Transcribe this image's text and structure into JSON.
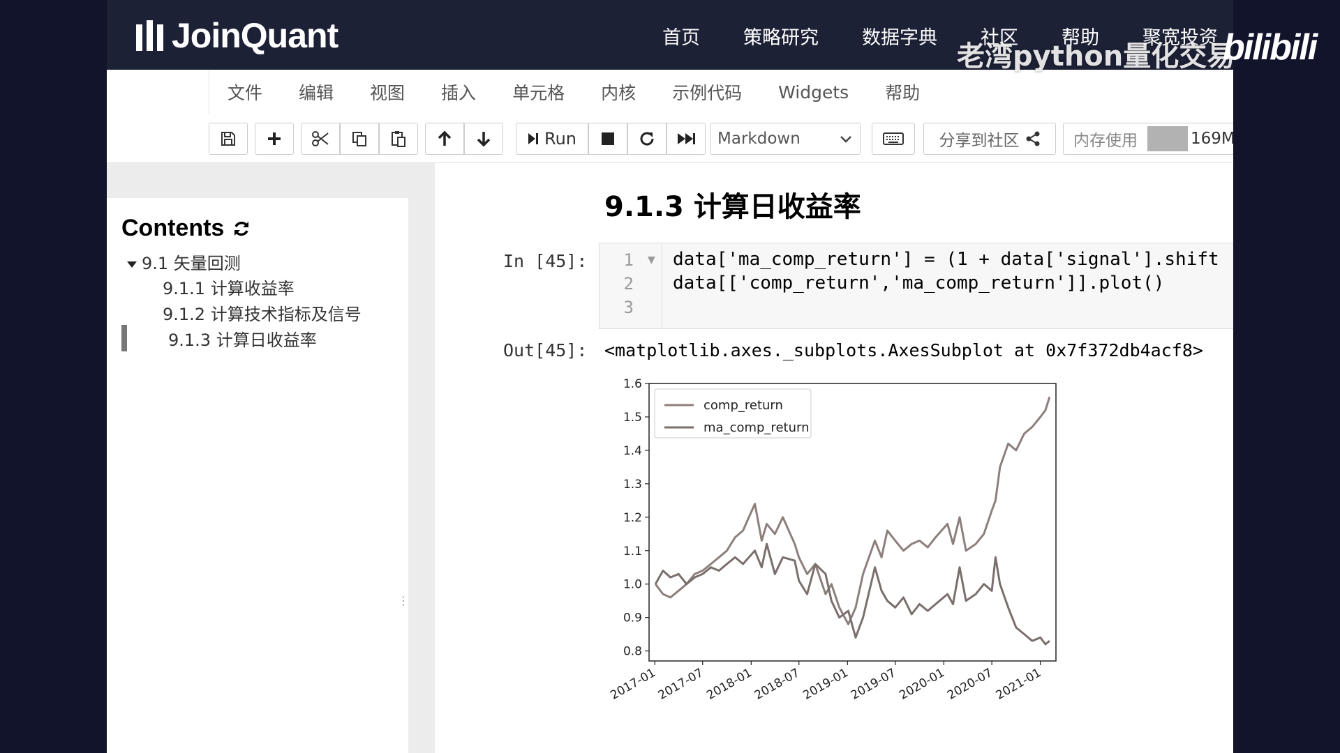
{
  "brand": {
    "name": "JoinQuant"
  },
  "top_nav": [
    "首页",
    "策略研究",
    "数据字典",
    "社区",
    "帮助",
    "聚宽投资"
  ],
  "watermark": {
    "text": "老湾python量化交易",
    "logo": "bilibili"
  },
  "menu": [
    "文件",
    "编辑",
    "视图",
    "插入",
    "单元格",
    "内核",
    "示例代码",
    "Widgets",
    "帮助"
  ],
  "toolbar": {
    "run_label": "Run",
    "cell_type": "Markdown",
    "share_label": "分享到社区",
    "memory_label": "内存使用",
    "memory_value": "169M",
    "memory_fraction": 0.3,
    "icons": [
      "save-icon",
      "plus-icon",
      "scissors-icon",
      "copy-icon",
      "paste-icon",
      "arrow-up-icon",
      "arrow-down-icon",
      "run-icon",
      "stop-icon",
      "restart-icon",
      "fast-forward-icon",
      "keyboard-icon",
      "share-icon"
    ]
  },
  "toc": {
    "title": "Contents",
    "items": [
      {
        "label": "9.1 矢量回测"
      },
      {
        "label": "9.1.1 计算收益率"
      },
      {
        "label": "9.1.2 计算技术指标及信号"
      },
      {
        "label": "9.1.3 计算日收益率"
      }
    ]
  },
  "notebook": {
    "heading": "9.1.3 计算日收益率",
    "in_prompt": "In [45]:",
    "out_prompt": "Out[45]:",
    "line_numbers": [
      "1",
      "2",
      "3"
    ],
    "code_lines": [
      "data['ma_comp_return'] = (1 + data['signal'].shift",
      "data[['comp_return','ma_comp_return']].plot()",
      ""
    ],
    "output_text": "<matplotlib.axes._subplots.AxesSubplot at 0x7f372db4acf8>"
  },
  "chart_data": {
    "type": "line",
    "title": "",
    "xlabel": "",
    "ylabel": "",
    "legend_position": "top-left",
    "grid": false,
    "ylim": [
      0.77,
      1.6
    ],
    "xlim": [
      "2016-12-10",
      "2021-03-01"
    ],
    "yticks": [
      "0.8",
      "0.9",
      "1.0",
      "1.1",
      "1.2",
      "1.3",
      "1.4",
      "1.5",
      "1.6"
    ],
    "xticks": [
      "2017-01",
      "2017-07",
      "2018-01",
      "2018-07",
      "2019-01",
      "2019-07",
      "2020-01",
      "2020-07",
      "2021-01"
    ],
    "series": [
      {
        "name": "comp_return",
        "color": "#8c7f7c",
        "x": [
          "2017-01-03",
          "2017-02-01",
          "2017-03-01",
          "2017-04-01",
          "2017-05-01",
          "2017-06-01",
          "2017-07-01",
          "2017-08-01",
          "2017-09-01",
          "2017-10-01",
          "2017-11-01",
          "2017-12-01",
          "2018-01-15",
          "2018-02-10",
          "2018-03-01",
          "2018-04-01",
          "2018-05-01",
          "2018-06-15",
          "2018-07-01",
          "2018-08-01",
          "2018-09-01",
          "2018-10-10",
          "2018-11-01",
          "2018-12-01",
          "2019-01-04",
          "2019-02-01",
          "2019-03-01",
          "2019-04-15",
          "2019-05-10",
          "2019-06-01",
          "2019-07-01",
          "2019-08-01",
          "2019-09-01",
          "2019-10-01",
          "2019-11-01",
          "2019-12-01",
          "2020-01-15",
          "2020-02-05",
          "2020-03-01",
          "2020-03-25",
          "2020-05-01",
          "2020-06-01",
          "2020-07-01",
          "2020-07-15",
          "2020-08-01",
          "2020-09-01",
          "2020-10-01",
          "2020-11-01",
          "2020-12-01",
          "2021-01-01",
          "2021-01-20",
          "2021-02-05"
        ],
        "y": [
          1.0,
          0.97,
          0.96,
          0.98,
          1.0,
          1.03,
          1.04,
          1.06,
          1.08,
          1.1,
          1.14,
          1.16,
          1.24,
          1.13,
          1.18,
          1.15,
          1.2,
          1.12,
          1.08,
          1.03,
          1.06,
          0.97,
          1.0,
          0.93,
          0.88,
          0.93,
          1.03,
          1.13,
          1.08,
          1.16,
          1.13,
          1.1,
          1.12,
          1.13,
          1.11,
          1.14,
          1.18,
          1.12,
          1.2,
          1.1,
          1.12,
          1.15,
          1.22,
          1.25,
          1.35,
          1.42,
          1.4,
          1.45,
          1.47,
          1.5,
          1.52,
          1.56
        ]
      },
      {
        "name": "ma_comp_return",
        "color": "#7a6f6c",
        "x": [
          "2017-01-03",
          "2017-02-01",
          "2017-03-01",
          "2017-04-01",
          "2017-05-01",
          "2017-06-01",
          "2017-07-01",
          "2017-08-01",
          "2017-09-01",
          "2017-10-01",
          "2017-11-01",
          "2017-12-01",
          "2018-01-15",
          "2018-02-10",
          "2018-03-01",
          "2018-04-01",
          "2018-05-01",
          "2018-06-15",
          "2018-07-01",
          "2018-08-01",
          "2018-09-01",
          "2018-10-10",
          "2018-11-01",
          "2018-12-01",
          "2019-01-04",
          "2019-02-01",
          "2019-03-01",
          "2019-04-15",
          "2019-05-10",
          "2019-06-01",
          "2019-07-01",
          "2019-08-01",
          "2019-09-01",
          "2019-10-01",
          "2019-11-01",
          "2019-12-01",
          "2020-01-15",
          "2020-02-05",
          "2020-03-01",
          "2020-03-25",
          "2020-05-01",
          "2020-06-01",
          "2020-07-01",
          "2020-07-15",
          "2020-08-01",
          "2020-09-01",
          "2020-10-01",
          "2020-11-01",
          "2020-12-01",
          "2021-01-01",
          "2021-01-20",
          "2021-02-05"
        ],
        "y": [
          1.0,
          1.04,
          1.02,
          1.03,
          1.0,
          1.02,
          1.03,
          1.05,
          1.04,
          1.06,
          1.08,
          1.06,
          1.1,
          1.05,
          1.12,
          1.03,
          1.08,
          1.07,
          1.01,
          0.97,
          1.06,
          1.03,
          0.95,
          0.9,
          0.92,
          0.84,
          0.9,
          1.05,
          0.98,
          0.95,
          0.93,
          0.96,
          0.91,
          0.94,
          0.92,
          0.94,
          0.97,
          0.94,
          1.05,
          0.95,
          0.97,
          1.0,
          0.98,
          1.08,
          1.0,
          0.93,
          0.87,
          0.85,
          0.83,
          0.84,
          0.82,
          0.83
        ]
      }
    ]
  }
}
